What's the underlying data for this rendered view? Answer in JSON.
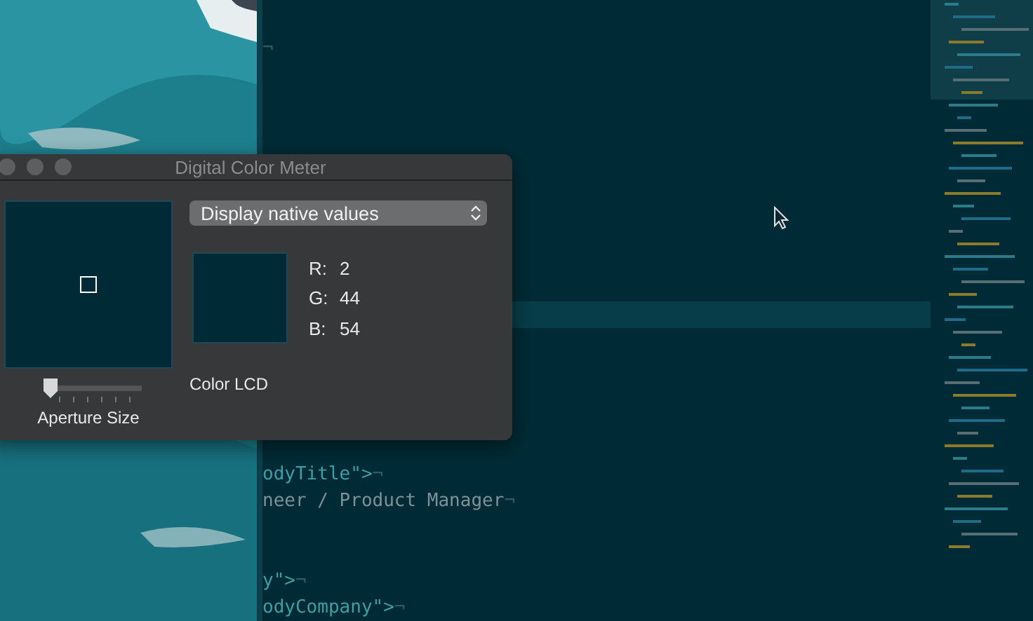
{
  "meter_window": {
    "title": "Digital Color Meter",
    "display_mode": "Display native values",
    "channels": [
      {
        "label": "R:",
        "value": "2"
      },
      {
        "label": "G:",
        "value": "44"
      },
      {
        "label": "B:",
        "value": "54"
      }
    ],
    "display_name": "Color LCD",
    "aperture": {
      "label": "Aperture Size",
      "level": 0
    }
  },
  "editor": {
    "current_line_highlight": true,
    "lines": [
      {
        "segments": [
          {
            "kind": "mark",
            "text": "¬"
          }
        ]
      },
      {
        "segments": [
          {
            "kind": "attr",
            "text": "odyTitle\">"
          },
          {
            "kind": "mark",
            "text": "¬"
          }
        ]
      },
      {
        "segments": [
          {
            "kind": "text",
            "text": "neer / Product Manager"
          },
          {
            "kind": "mark",
            "text": "¬"
          }
        ]
      },
      {
        "segments": [
          {
            "kind": "attr",
            "text": "y\">"
          },
          {
            "kind": "mark",
            "text": "¬"
          }
        ]
      },
      {
        "segments": [
          {
            "kind": "attr",
            "text": "odyCompany\">"
          },
          {
            "kind": "mark",
            "text": "¬"
          }
        ]
      }
    ]
  }
}
